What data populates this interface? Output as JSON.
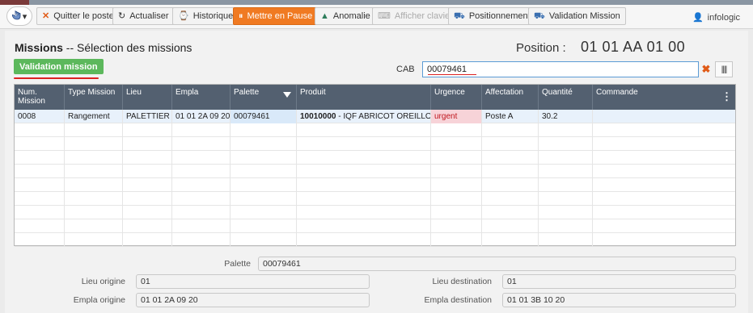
{
  "toolbar": {
    "hand_caret": "▾",
    "buttons": [
      {
        "label": "Quitter le poste",
        "icon": "close-icon"
      },
      {
        "label": "Actualiser",
        "icon": "refresh-icon"
      },
      {
        "label": "Historique",
        "icon": "history-icon"
      },
      {
        "label": "Mettre en Pause",
        "icon": "pause-icon"
      },
      {
        "label": "Anomalie",
        "icon": "warning-icon"
      },
      {
        "label": "Afficher clavier",
        "icon": "keyboard-icon"
      },
      {
        "label": "Positionnement",
        "icon": "forklift-icon"
      },
      {
        "label": "Validation Mission",
        "icon": "forklift-icon"
      }
    ],
    "brand": "infologic"
  },
  "page": {
    "title_bold": "Missions",
    "title_rest": " -- Sélection des missions",
    "position_label": "Position :",
    "position_value": "01 01 AA 01 00",
    "validation_button": "Validation mission"
  },
  "cab": {
    "label": "CAB",
    "value": "00079461"
  },
  "grid": {
    "columns": [
      "Num. Mission",
      "Type Mission",
      "Lieu",
      "Empla",
      "Palette",
      "Produit",
      "Urgence",
      "Affectation",
      "Quantité",
      "Commande"
    ],
    "rows": [
      {
        "num_mission": "0008",
        "type_mission": "Rangement",
        "lieu": "PALETTIER",
        "empla": "01 01 2A 09 20",
        "palette": "00079461",
        "produit_code": "10010000",
        "produit_label": " - IQF ABRICOT OREILLO...",
        "urgence": "urgent",
        "affectation": "Poste A",
        "quantite": "30.2",
        "commande": ""
      }
    ],
    "menu_icon": "⋮"
  },
  "details": {
    "palette_label": "Palette",
    "palette_value": "00079461",
    "lieu_origine_label": "Lieu origine",
    "lieu_origine_value": "01",
    "lieu_destination_label": "Lieu destination",
    "lieu_destination_value": "01",
    "empla_origine_label": "Empla origine",
    "empla_origine_value": "01 01 2A 09 20",
    "empla_destination_label": "Empla destination",
    "empla_destination_value": "01 01 3B 10 20"
  },
  "colors": {
    "accent_orange": "#f07a22",
    "success_green": "#5cb85c",
    "grid_header": "#536070",
    "urgent_bg": "#f7d3d8",
    "urgent_text": "#c0161d"
  }
}
